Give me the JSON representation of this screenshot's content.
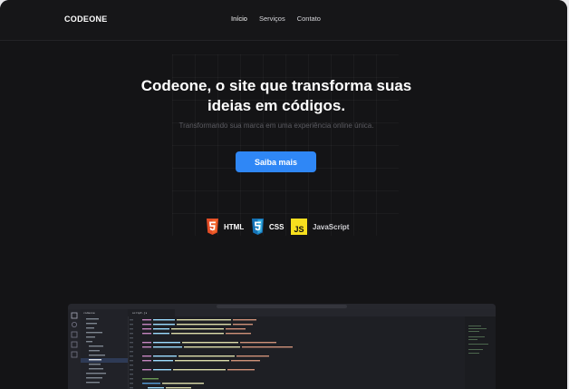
{
  "header": {
    "logo": "CODEONE",
    "nav": [
      {
        "label": "Início",
        "active": true
      },
      {
        "label": "Serviços",
        "active": false
      },
      {
        "label": "Contato",
        "active": false
      }
    ]
  },
  "hero": {
    "title_line1": "Codeone, o site que transforma suas",
    "title_line2": "ideias em códigos.",
    "subtitle": "Transformando sua marca em uma experiência online única.",
    "cta_label": "Saiba mais"
  },
  "techs": [
    {
      "label": "HTML",
      "icon": "html5-icon",
      "color": "#e44d26"
    },
    {
      "label": "CSS",
      "icon": "css3-icon",
      "color": "#1572b6"
    },
    {
      "label": "JavaScript",
      "icon": "javascript-icon",
      "color": "#f7df1e"
    }
  ],
  "editor": {
    "tab_label": "script.js",
    "explorer_title": "codeone"
  },
  "colors": {
    "background": "#141416",
    "accent": "#2f87f6",
    "text": "#ffffff",
    "muted": "#5c5c62"
  }
}
